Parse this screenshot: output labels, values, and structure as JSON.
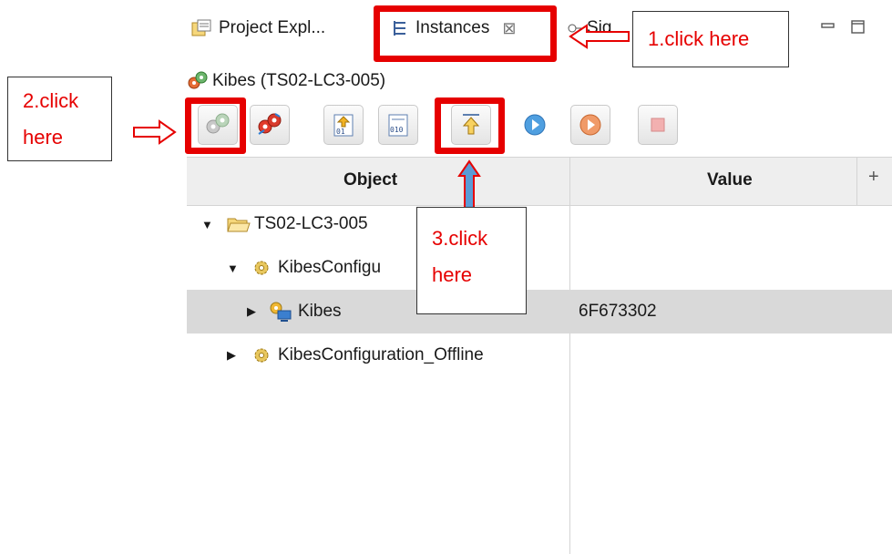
{
  "tabs": [
    {
      "label": "Project Expl..."
    },
    {
      "label": "Instances",
      "close": "⊠"
    },
    {
      "label": "Sig"
    }
  ],
  "panel": {
    "title": "Kibes (TS02-LC3-005)"
  },
  "toolbar": {
    "buttons": [
      "connect-icon",
      "gear-network-icon",
      "upload-binary-icon",
      "binary-file-icon",
      "upload-icon",
      "play-icon",
      "record-icon",
      "stop-icon"
    ]
  },
  "table": {
    "columns": [
      "Object",
      "Value"
    ],
    "add_column": "+",
    "rows": [
      {
        "indent": 0,
        "expanded": true,
        "icon": "folder-icon",
        "label": "TS02-LC3-005",
        "value": ""
      },
      {
        "indent": 1,
        "expanded": true,
        "icon": "config-icon",
        "label": "KibesConfigu",
        "value": ""
      },
      {
        "indent": 2,
        "expanded": false,
        "icon": "device-icon",
        "label": "Kibes",
        "value": "6F673302",
        "selected": true
      },
      {
        "indent": 1,
        "expanded": false,
        "icon": "config-icon",
        "label": "KibesConfiguration_Offline",
        "value": ""
      }
    ]
  },
  "annotations": {
    "callout1": "1.click here",
    "callout2_line1": "2.click",
    "callout2_line2": "here",
    "callout3_line1": "3.click",
    "callout3_line2": "here"
  },
  "colors": {
    "annotation_red": "#e60000",
    "annotation_blue": "#5b9bd5",
    "selection": "#d9d9d9"
  }
}
